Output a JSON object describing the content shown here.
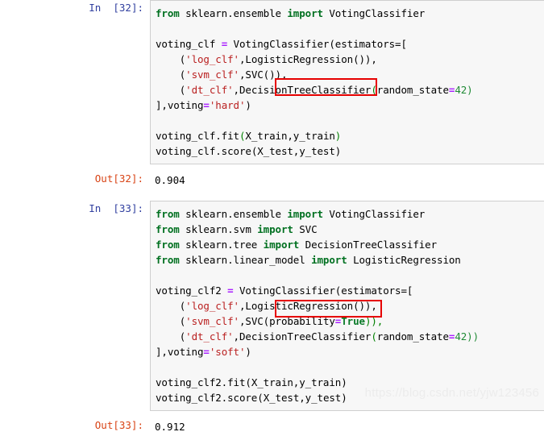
{
  "notebook": {
    "cells": [
      {
        "type": "code",
        "prompt_in": "In  [32]:",
        "prompt_out": "Out[32]:",
        "source_lines": [
          "from sklearn.ensemble import VotingClassifier",
          "",
          "voting_clf = VotingClassifier(estimators=[",
          "    ('log_clf',LogisticRegression()),",
          "    ('svm_clf',SVC()),",
          "    ('dt_clf',DecisionTreeClassifier(random_state=42)",
          "],voting='hard')",
          "",
          "voting_clf.fit(X_train,y_train)",
          "voting_clf.score(X_test,y_test)"
        ],
        "output": "0.904"
      },
      {
        "type": "code",
        "prompt_in": "In  [33]:",
        "prompt_out": "Out[33]:",
        "source_lines": [
          "from sklearn.ensemble import VotingClassifier",
          "from sklearn.svm import SVC",
          "from sklearn.tree import DecisionTreeClassifier",
          "from sklearn.linear_model import LogisticRegression",
          "",
          "voting_clf2 = VotingClassifier(estimators=[",
          "    ('log_clf',LogisticRegression()),",
          "    ('svm_clf',SVC(probability=True)),",
          "    ('dt_clf',DecisionTreeClassifier(random_state=42))",
          "],voting='soft')",
          "",
          "voting_clf2.fit(X_train,y_train)",
          "voting_clf2.score(X_test,y_test)"
        ],
        "output": "0.912"
      }
    ],
    "cell1": {
      "prompt_in": "In  [32]:",
      "prompt_out": "Out[32]:",
      "output_value": "0.904",
      "line1_kw_from": "from",
      "line1_mod": " sklearn.ensemble ",
      "line1_kw_import": "import",
      "line1_cls": " VotingClassifier",
      "line3_name": "voting_clf ",
      "line3_eq": "=",
      "line3_rest": " VotingClassifier(estimators=[",
      "line4_indent": "    (",
      "line4_str": "'log_clf'",
      "line4_rest": ",LogisticRegression()),",
      "line5_indent": "    (",
      "line5_str": "'svm_clf'",
      "line5_rest": ",SVC()),",
      "line6_indent": "    (",
      "line6_str": "'dt_clf'",
      "line6_mid": ",DecisionTreeClassifier",
      "line6_paren_open": "(",
      "line6_arg": "random_state",
      "line6_eq": "=",
      "line6_val": "42)",
      "line7_pre": "],voting",
      "line7_eq": "=",
      "line7_str": "'hard'",
      "line7_post": ")",
      "line9_pre": "voting_clf.fit",
      "line9_paren1": "(",
      "line9_args": "X_train,y_train",
      "line9_paren2": ")",
      "line10_pre": "voting_clf.score",
      "line10_paren1": "(",
      "line10_args": "X_test,y_test",
      "line10_paren2": ")"
    },
    "cell2": {
      "prompt_in": "In  [33]:",
      "prompt_out": "Out[33]:",
      "output_value": "0.912",
      "imp1_from": "from",
      "imp1_mod": " sklearn.ensemble ",
      "imp1_import": "import",
      "imp1_name": " VotingClassifier",
      "imp2_from": "from",
      "imp2_mod": " sklearn.svm ",
      "imp2_import": "import",
      "imp2_name": " SVC",
      "imp3_from": "from",
      "imp3_mod": " sklearn.tree ",
      "imp3_import": "import",
      "imp3_name": " DecisionTreeClassifier",
      "imp4_from": "from",
      "imp4_mod": " sklearn.linear_model ",
      "imp4_import": "import",
      "imp4_name": " LogisticRegression",
      "line6_name": "voting_clf2 ",
      "line6_eq": "=",
      "line6_rest": " VotingClassifier(estimators=[",
      "line7_indent": "    (",
      "line7_str": "'log_clf'",
      "line7_rest": ",LogisticRegression()),",
      "line8_indent": "    (",
      "line8_str": "'svm_clf'",
      "line8_mid": ",SVC(probability",
      "line8_eq": "=",
      "line8_true": "True",
      "line8_post": ")),",
      "line9_indent": "    (",
      "line9_str": "'dt_clf'",
      "line9_mid": ",DecisionTreeClassifier",
      "line9_paren_open": "(",
      "line9_arg": "random_state",
      "line9_eq": "=",
      "line9_val": "42))",
      "line10_pre": "],voting",
      "line10_eq": "=",
      "line10_str": "'soft'",
      "line10_post": ")",
      "line12_pre": "voting_clf2.fit",
      "line12_paren1": "(",
      "line12_args": "X_train,y_train",
      "line12_paren2": ")",
      "line13_pre": "voting_clf2.score",
      "line13_paren1": "(",
      "line13_args": "X_test,y_test",
      "line13_paren2": ")"
    }
  },
  "annotations": {
    "highlight_color": "#e60000",
    "box1_label": "random-state-highlight-1",
    "box2_label": "random-state-highlight-2"
  },
  "watermark": {
    "text": "https://blog.csdn.net/yjw123456"
  },
  "colors": {
    "prompt_in": "#303F9F",
    "prompt_out": "#D84315",
    "cell_bg": "#f7f7f7",
    "cell_border": "#cfcfcf",
    "keyword": "#007020",
    "string": "#BA2121",
    "operator": "#AA22FF",
    "number": "#1f8a35"
  }
}
